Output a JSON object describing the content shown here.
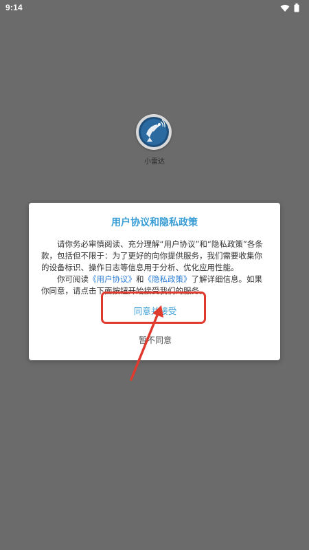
{
  "status_bar": {
    "time": "9:14",
    "icons": [
      "wifi-icon",
      "battery-icon"
    ]
  },
  "home": {
    "app_icon": "radar-dish-icon",
    "app_label": "小雷达"
  },
  "dialog": {
    "title": "用户协议和隐私政策",
    "para1": "请你务必审慎阅读、充分理解“用户协议”和“隐私政策”各条款，包括但不限于：为了更好的向你提供服务，我们需要收集你的设备标识、操作日志等信息用于分析、优化应用性能。",
    "para2_prefix": "你可阅读",
    "user_agreement_link": "《用户协议》",
    "para2_and": "和",
    "privacy_policy_link": "《隐私政策》",
    "para2_suffix": "了解详细信息。如果你同意，请点击下面按钮开始接受我们的服务。",
    "agree_button": "同意并接受",
    "disagree_button": "暂不同意"
  },
  "colors": {
    "accent": "#3a9ed6",
    "link": "#2f7fd6",
    "annotation": "#e03a2f",
    "overlay": "#6b6b6b"
  }
}
